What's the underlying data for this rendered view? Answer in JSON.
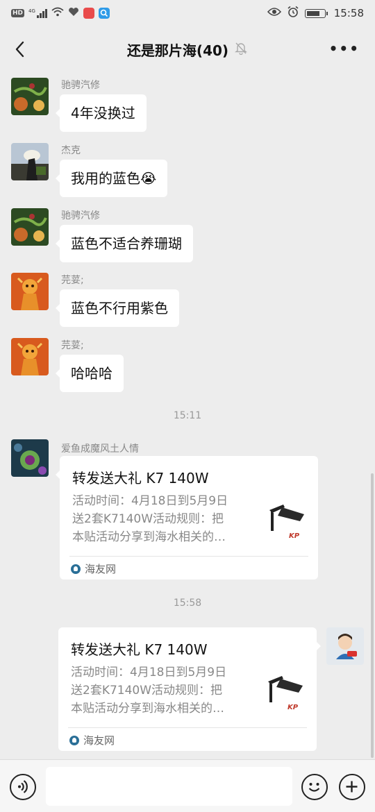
{
  "status_bar": {
    "hd": "HD",
    "network": "4G",
    "time": "15:58",
    "icons": [
      "hd-icon",
      "signal-icon",
      "wifi-icon",
      "heart-icon",
      "app-red-icon",
      "app-search-icon",
      "eye-icon",
      "alarm-icon",
      "battery-icon"
    ]
  },
  "header": {
    "title": "还是那片海(40)",
    "muted_icon": "bell-off-icon",
    "more_icon": "more-icon",
    "more_label": "•••"
  },
  "messages": [
    {
      "sender": "驰骋汽修",
      "text": "4年没换过",
      "avatar": "avatar-fish-tank"
    },
    {
      "sender": "杰克",
      "text": "我用的蓝色😭",
      "avatar": "avatar-outdoor"
    },
    {
      "sender": "驰骋汽修",
      "text": "蓝色不适合养珊瑚",
      "avatar": "avatar-fish-tank"
    },
    {
      "sender": "芫荽;",
      "text": "蓝色不行用紫色",
      "avatar": "avatar-orange"
    },
    {
      "sender": "芫荽;",
      "text": "哈哈哈",
      "avatar": "avatar-orange"
    }
  ],
  "timestamps": [
    "15:11",
    "15:58"
  ],
  "shared_cards": [
    {
      "sender": "爱鱼成魔风土人情",
      "title": "转发送大礼 K7 140W",
      "desc_lines": [
        "活动时间：4月18日到5月9日",
        "送2套K7140W活动规则：把",
        "本贴活动分享到海水相关的…"
      ],
      "source": "海友网",
      "thumb_text": "KP"
    },
    {
      "title": "转发送大礼 K7 140W",
      "desc_lines": [
        "活动时间：4月18日到5月9日",
        "送2套K7140W活动规则：把",
        "本贴活动分享到海水相关的…"
      ],
      "source": "海友网",
      "thumb_text": "KP"
    }
  ],
  "input_bar": {
    "icons": [
      "voice-icon",
      "emoji-icon",
      "plus-icon"
    ]
  },
  "colors": {
    "background": "#ededed",
    "bubble": "#ffffff",
    "text": "#111111",
    "meta": "#888888"
  }
}
